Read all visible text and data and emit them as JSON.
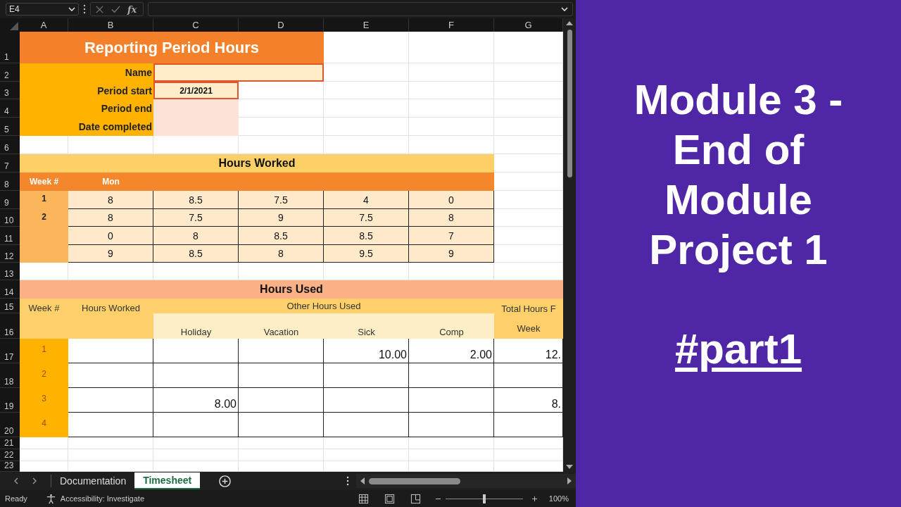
{
  "formula_bar": {
    "name_box": "E4",
    "function_label": "fx"
  },
  "sheet": {
    "column_letters": [
      "A",
      "B",
      "C",
      "D",
      "E",
      "F",
      "G"
    ],
    "row_numbers": [
      "1",
      "2",
      "3",
      "4",
      "5",
      "6",
      "7",
      "8",
      "9",
      "10",
      "11",
      "12",
      "13",
      "14",
      "15",
      "16",
      "17",
      "18",
      "19",
      "20",
      "21",
      "22",
      "23"
    ],
    "title": "Reporting Period Hours",
    "form": [
      {
        "label": "Name"
      },
      {
        "label": "Period start",
        "value": "2/1/2021"
      },
      {
        "label": "Period end"
      },
      {
        "label": "Date completed"
      }
    ],
    "hours_worked": {
      "title": "Hours Worked",
      "headers": [
        "Week #",
        "Mon"
      ],
      "weeks": [
        "1",
        "2"
      ],
      "rows": [
        [
          "8",
          "8.5",
          "7.5",
          "4",
          "0"
        ],
        [
          "8",
          "7.5",
          "9",
          "7.5",
          "8"
        ],
        [
          "0",
          "8",
          "8.5",
          "8.5",
          "7"
        ],
        [
          "9",
          "8.5",
          "8",
          "9.5",
          "9"
        ]
      ]
    },
    "hours_used": {
      "title": "Hours Used",
      "week_header": "Week #",
      "hours_worked_header": "Hours Worked",
      "group_header": "Other Hours Used",
      "sub_headers": [
        "Holiday",
        "Vacation",
        "Sick",
        "Comp"
      ],
      "total_header": [
        "Total Hours F",
        "Week"
      ],
      "rows": [
        {
          "week": "1",
          "sick": "10.00",
          "comp": "2.00",
          "total": "12."
        },
        {
          "week": "2"
        },
        {
          "week": "3",
          "holiday": "8.00",
          "total": "8."
        },
        {
          "week": "4"
        }
      ]
    }
  },
  "sheet_tabs": [
    {
      "label": "Documentation",
      "selected": false
    },
    {
      "label": "Timesheet",
      "selected": true
    }
  ],
  "status_bar": {
    "status": "Ready",
    "accessibility": "Accessibility: Investigate",
    "zoom": "100%",
    "zoom_slider": {
      "level": 0.5
    }
  },
  "banner": {
    "title_lines": [
      "Module 3 -",
      "End of",
      "Module",
      "Project 1"
    ],
    "tag": "#part1"
  }
}
